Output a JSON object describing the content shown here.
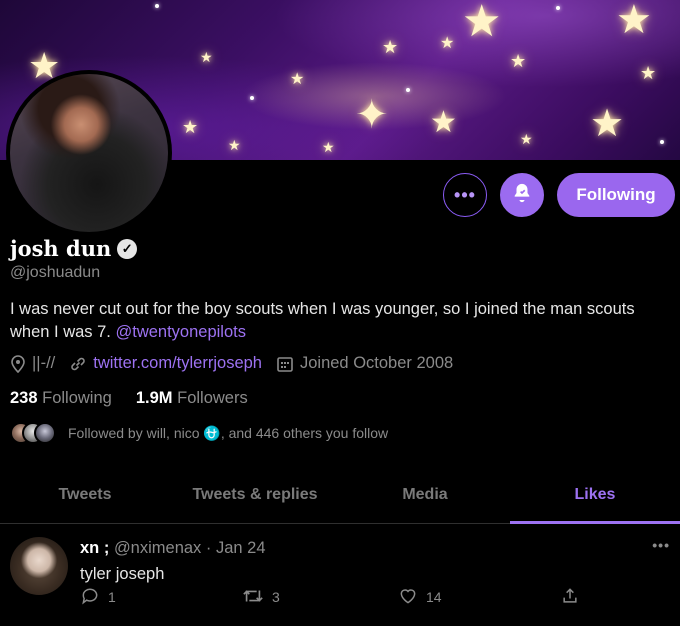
{
  "profile": {
    "name": "josh dun",
    "handle": "@joshuadun",
    "bio_text": "I was never cut out for the boy scouts when I was younger, so I joined the man scouts when I was 7. ",
    "bio_mention": "@twentyonepilots",
    "location": "||-//",
    "website": "twitter.com/tylerrjoseph",
    "joined": "Joined October 2008",
    "following_count": "238",
    "following_label": "Following",
    "followers_count": "1.9M",
    "followers_label": "Followers",
    "followed_by": "Followed by will, nico ⛎, and 446 others you follow"
  },
  "actions": {
    "more_label": "•••",
    "following_button": "Following"
  },
  "tabs": [
    {
      "label": "Tweets",
      "active": false
    },
    {
      "label": "Tweets & replies",
      "active": false
    },
    {
      "label": "Media",
      "active": false
    },
    {
      "label": "Likes",
      "active": true
    }
  ],
  "tweet": {
    "name": "xn ;",
    "handle": "@nximenax",
    "date": "Jan 24",
    "text": "tyler joseph",
    "replies": "1",
    "retweets": "3",
    "likes": "14"
  },
  "colors": {
    "accent": "#9d72f2",
    "button": "#9a67ee",
    "background": "#000000",
    "secondary_text": "#8b8b8b"
  },
  "icons": [
    "verified-badge-icon",
    "bell-icon",
    "location-icon",
    "link-icon",
    "calendar-icon",
    "reply-icon",
    "retweet-icon",
    "heart-icon",
    "share-icon",
    "more-icon"
  ]
}
